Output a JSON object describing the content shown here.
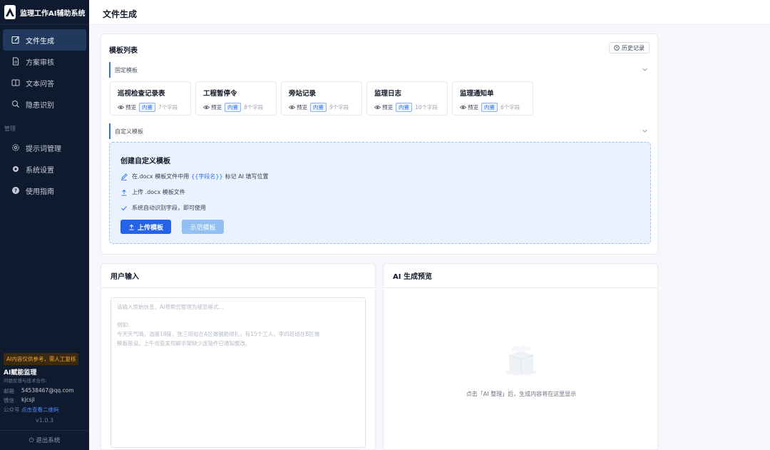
{
  "app": {
    "title": "监理工作AI辅助系统",
    "page_title": "文件生成"
  },
  "sidebar": {
    "items": [
      {
        "label": "文件生成",
        "icon": "edit-icon",
        "active": true
      },
      {
        "label": "方案审核",
        "icon": "document-icon"
      },
      {
        "label": "文本问答",
        "icon": "book-icon"
      },
      {
        "label": "隐患识别",
        "icon": "search-icon"
      }
    ],
    "section_label": "管理",
    "admin_items": [
      {
        "label": "提示词管理",
        "icon": "gear-icon"
      },
      {
        "label": "系统设置",
        "icon": "settings-icon"
      },
      {
        "label": "使用指南",
        "icon": "help-icon"
      }
    ],
    "disclaimer": "AI内容仅供参考，需人工复核",
    "org_name": "AI赋能监理",
    "org_sub": "问题反馈与技术合作:",
    "contacts": [
      {
        "key": "邮箱",
        "value": "54538467@qq.com"
      },
      {
        "key": "微信",
        "value": "kjcsjl"
      },
      {
        "key": "公众号",
        "value": "点击查看二维码"
      }
    ],
    "version": "v1.0.3",
    "logout": "退出系统"
  },
  "templates": {
    "title": "模板列表",
    "history_label": "历史记录",
    "fixed_section": "固定模板",
    "custom_section": "自定义模板",
    "preview_label": "预览",
    "tag_label": "内置",
    "items": [
      {
        "name": "巡视检查记录表",
        "count": "7个字段"
      },
      {
        "name": "工程暂停令",
        "count": "8个字段"
      },
      {
        "name": "旁站记录",
        "count": "9个字段"
      },
      {
        "name": "监理日志",
        "count": "10个字段"
      },
      {
        "name": "监理通知单",
        "count": "6个字段"
      }
    ]
  },
  "create": {
    "title": "创建自定义模板",
    "step1_pre": "在.docx 模板文件中用",
    "step1_hl": "{{字段名}}",
    "step1_post": "标记 AI 填写位置",
    "step2": "上传 .docx 模板文件",
    "step3": "系统自动识别字段，即可使用",
    "upload_label": "上传模板",
    "example_label": "示范模板"
  },
  "input_panel": {
    "title": "用户输入",
    "placeholder_line1": "请输入原始信息，AI将帮您整理为规范格式...",
    "placeholder_line2": "例如:",
    "placeholder_line3": "今天天气晴，温度18度，张三班组在A区做钢筋绑扎，有15个工人，李四班组在B区做",
    "placeholder_line4": "模板搭设。上午巡查发现脚手架缺少连墙件已通知整改。"
  },
  "preview_panel": {
    "title": "AI 生成预览",
    "empty_text": "点击「AI 整理」后，生成内容将在这里显示"
  }
}
